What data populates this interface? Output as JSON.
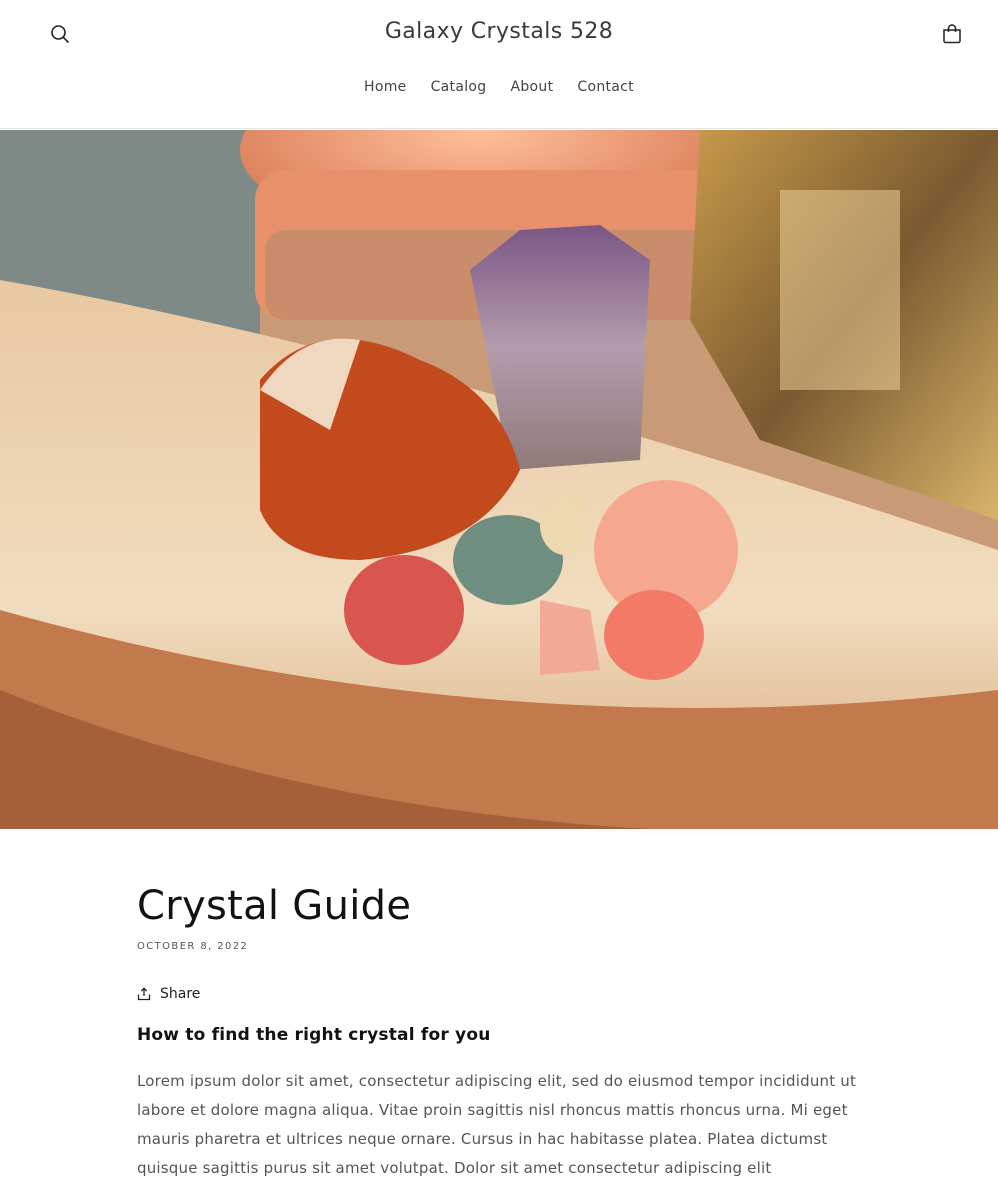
{
  "header": {
    "store_name": "Galaxy Crystals 528",
    "search_icon": "search-icon",
    "cart_icon": "cart-icon"
  },
  "nav": {
    "items": [
      {
        "label": "Home"
      },
      {
        "label": "Catalog"
      },
      {
        "label": "About"
      },
      {
        "label": "Contact"
      }
    ]
  },
  "article": {
    "title": "Crystal Guide",
    "date": "OCTOBER 8, 2022",
    "share_label": "Share",
    "share_icon": "share-icon",
    "subtitle": "How to find the right crystal for you",
    "body": "Lorem ipsum dolor sit amet, consectetur adipiscing elit, sed do eiusmod tempor incididunt ut labore et dolore magna aliqua. Vitae proin sagittis nisl rhoncus mattis rhoncus urna. Mi eget mauris pharetra et ultrices neque ornare. Cursus in hac habitasse platea. Platea dictumst quisque sagittis purus sit amet volutpat. Dolor sit amet consectetur adipiscing elit pellentesque habitant. Enim ut"
  },
  "colors": {
    "text": "#121212",
    "muted": "#555555",
    "border": "#e6e6e6"
  }
}
